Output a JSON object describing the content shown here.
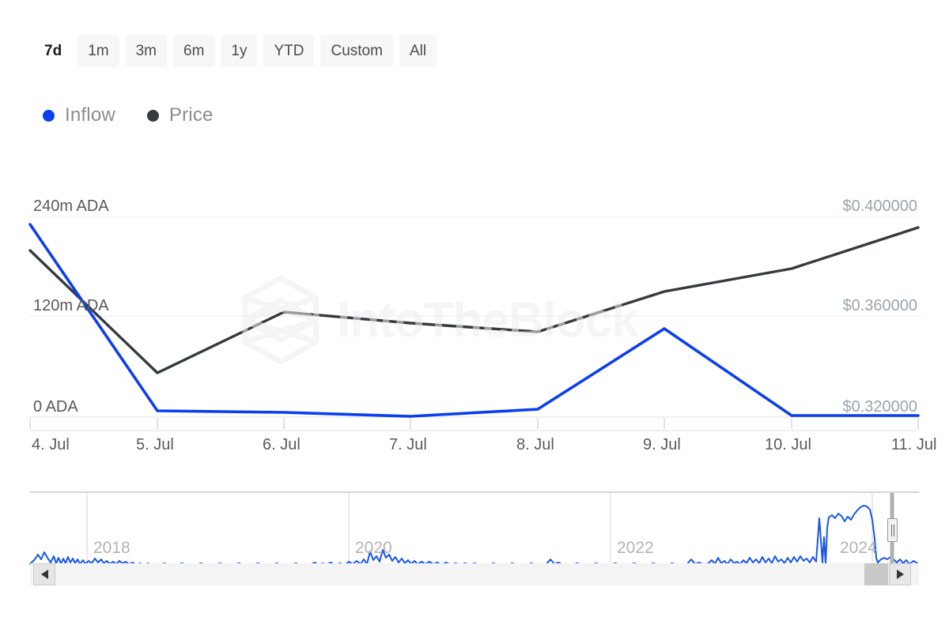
{
  "range_selector": {
    "buttons": [
      {
        "label": "7d",
        "active": true
      },
      {
        "label": "1m",
        "active": false
      },
      {
        "label": "3m",
        "active": false
      },
      {
        "label": "6m",
        "active": false
      },
      {
        "label": "1y",
        "active": false
      },
      {
        "label": "YTD",
        "active": false
      },
      {
        "label": "Custom",
        "active": false
      },
      {
        "label": "All",
        "active": false
      }
    ]
  },
  "legend": {
    "items": [
      {
        "label": "Inflow",
        "color": "#0b3ef0"
      },
      {
        "label": "Price",
        "color": "#333a40"
      }
    ]
  },
  "watermark": {
    "text": "IntoTheBlock",
    "logo": "hexagon-logo-icon"
  },
  "navigator": {
    "year_labels": [
      "2018",
      "2020",
      "2022",
      "2024"
    ],
    "left_scroll_label": "◀",
    "right_scroll_label": "▶",
    "handle_name": "right-range-handle"
  },
  "colors": {
    "inflow": "#0b3ef0",
    "price": "#333a40",
    "grid": "#ebebeb",
    "axis_text": "#5a5a5a",
    "price_axis_text": "#9aa3ad",
    "button_bg": "#f7f7f7"
  },
  "chart_data": {
    "type": "line",
    "title": "",
    "xlabel": "",
    "grid": true,
    "legend_position": "top-left",
    "categories": [
      "4. Jul",
      "5. Jul",
      "6. Jul",
      "7. Jul",
      "8. Jul",
      "9. Jul",
      "10. Jul",
      "11. Jul"
    ],
    "axes": {
      "left": {
        "label": "ADA",
        "ticks": [
          "0 ADA",
          "120m ADA",
          "240m ADA"
        ],
        "tick_values": [
          0,
          120000000,
          240000000
        ],
        "ylim": [
          0,
          240000000
        ]
      },
      "right": {
        "label": "Price",
        "ticks": [
          "$0.320000",
          "$0.360000",
          "$0.400000"
        ],
        "tick_values": [
          0.32,
          0.36,
          0.4
        ],
        "ylim": [
          0.32,
          0.4
        ]
      }
    },
    "series": [
      {
        "name": "Inflow",
        "color": "#0b3ef0",
        "axis": "left",
        "unit": "ADA",
        "values": [
          232000000,
          8000000,
          6000000,
          1000000,
          9000000,
          97000000,
          2000000,
          2000000
        ]
      },
      {
        "name": "Price",
        "color": "#333a40",
        "axis": "right",
        "unit": "USD",
        "values": [
          0.3905,
          0.3455,
          0.3625,
          0.358,
          0.3545,
          0.3705,
          0.3795,
          0.3965
        ]
      }
    ],
    "navigator": {
      "type": "line",
      "series_name": "Inflow",
      "color": "#0b3ef0",
      "xlabels": [
        "2018",
        "2020",
        "2022",
        "2024"
      ],
      "selected_range": "7d"
    }
  }
}
